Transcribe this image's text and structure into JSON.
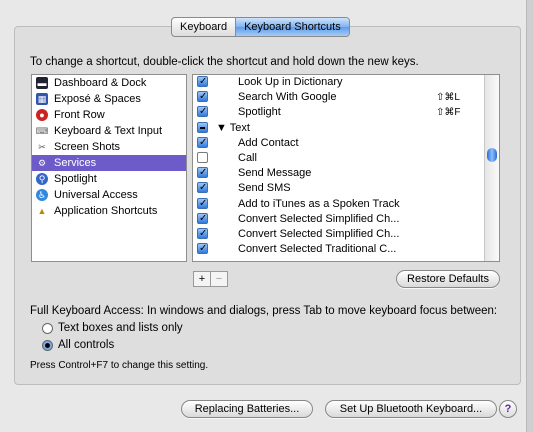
{
  "tabs": [
    {
      "label": "Keyboard",
      "active": false
    },
    {
      "label": "Keyboard Shortcuts",
      "active": true
    }
  ],
  "instruction": "To change a shortcut, double-click the shortcut and hold down the new keys.",
  "categories": [
    {
      "label": "Dashboard & Dock",
      "icon": "dashboard-dock-icon"
    },
    {
      "label": "Exposé & Spaces",
      "icon": "expose-spaces-icon"
    },
    {
      "label": "Front Row",
      "icon": "front-row-icon"
    },
    {
      "label": "Keyboard & Text Input",
      "icon": "keyboard-icon"
    },
    {
      "label": "Screen Shots",
      "icon": "screen-shots-icon"
    },
    {
      "label": "Services",
      "icon": "gear-icon",
      "selected": true
    },
    {
      "label": "Spotlight",
      "icon": "spotlight-icon"
    },
    {
      "label": "Universal Access",
      "icon": "universal-access-icon"
    },
    {
      "label": "Application Shortcuts",
      "icon": "application-shortcuts-icon"
    }
  ],
  "shortcuts": [
    {
      "name": "Look Up in Dictionary",
      "state": "on",
      "shortcut": ""
    },
    {
      "name": "Search With Google",
      "state": "on",
      "shortcut": "⇧⌘L"
    },
    {
      "name": "Spotlight",
      "state": "on",
      "shortcut": "⇧⌘F"
    },
    {
      "name": "▼ Text",
      "state": "mixed",
      "shortcut": "",
      "group": true
    },
    {
      "name": "Add Contact",
      "state": "on",
      "shortcut": ""
    },
    {
      "name": "Call",
      "state": "off",
      "shortcut": ""
    },
    {
      "name": "Send Message",
      "state": "on",
      "shortcut": ""
    },
    {
      "name": "Send SMS",
      "state": "on",
      "shortcut": ""
    },
    {
      "name": "Add to iTunes as a Spoken Track",
      "state": "on",
      "shortcut": ""
    },
    {
      "name": "Convert Selected Simplified Ch...",
      "state": "on",
      "shortcut": ""
    },
    {
      "name": "Convert Selected Simplified Ch...",
      "state": "on",
      "shortcut": ""
    },
    {
      "name": "Convert Selected Traditional C...",
      "state": "on",
      "shortcut": ""
    }
  ],
  "plus_label": "+",
  "minus_label": "−",
  "restore_defaults": "Restore Defaults",
  "full_keyboard_access": "Full Keyboard Access: In windows and dialogs, press Tab to move keyboard focus between:",
  "radio_options": [
    {
      "label": "Text boxes and lists only",
      "selected": false
    },
    {
      "label": "All controls",
      "selected": true
    }
  ],
  "hint": "Press Control+F7 to change this setting.",
  "replacing_batteries": "Replacing Batteries...",
  "bluetooth_keyboard": "Set Up Bluetooth Keyboard...",
  "help_label": "?",
  "colors": {
    "selection": "#6d5bc9",
    "accent": "#2e7be0"
  }
}
